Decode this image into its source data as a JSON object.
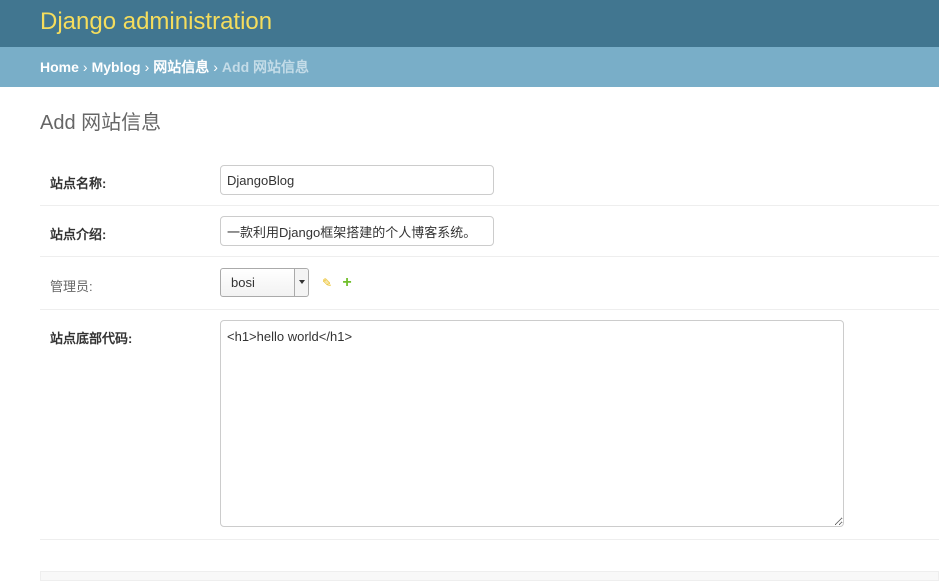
{
  "header": {
    "site_name": "Django administration"
  },
  "breadcrumbs": {
    "home": "Home",
    "sep": "›",
    "app": "Myblog",
    "model": "网站信息",
    "current": "Add 网站信息"
  },
  "page": {
    "title": "Add 网站信息"
  },
  "form": {
    "site_name": {
      "label": "站点名称:",
      "value": "DjangoBlog"
    },
    "site_description": {
      "label": "站点介绍:",
      "value": "一款利用Django框架搭建的个人博客系统。"
    },
    "admin": {
      "label": "管理员:",
      "selected": "bosi",
      "edit_icon": "pencil-icon",
      "add_icon": "plus-icon"
    },
    "footer_code": {
      "label": "站点底部代码:",
      "value": "<h1>hello world</h1>"
    }
  },
  "colors": {
    "header_bg": "#417690",
    "site_name": "#f5dd5d",
    "breadcrumbs_bg": "#79aec8",
    "edit_icon": "#e8b80e",
    "add_icon": "#70bf2b"
  }
}
